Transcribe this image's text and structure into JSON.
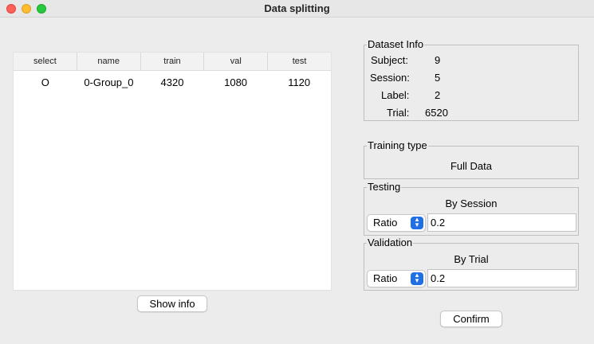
{
  "window": {
    "title": "Data splitting"
  },
  "table": {
    "columns": [
      "select",
      "name",
      "train",
      "val",
      "test"
    ],
    "rows": [
      {
        "select": "O",
        "name": "0-Group_0",
        "train": "4320",
        "val": "1080",
        "test": "1120"
      }
    ]
  },
  "show_info_label": "Show info",
  "dataset_info": {
    "title": "Dataset Info",
    "subject_label": "Subject:",
    "subject_value": "9",
    "session_label": "Session:",
    "session_value": "5",
    "label_label": "Label:",
    "label_value": "2",
    "trial_label": "Trial:",
    "trial_value": "6520"
  },
  "training_type": {
    "title": "Training type",
    "value": "Full Data"
  },
  "testing": {
    "title": "Testing",
    "mode": "By Session",
    "select_value": "Ratio",
    "input_value": "0.2"
  },
  "validation": {
    "title": "Validation",
    "mode": "By Trial",
    "select_value": "Ratio",
    "input_value": "0.2"
  },
  "confirm_label": "Confirm",
  "colors": {
    "accent": "#1f6fe5",
    "close": "#fe5f57",
    "minimize": "#febc2e",
    "zoom": "#28c840"
  }
}
